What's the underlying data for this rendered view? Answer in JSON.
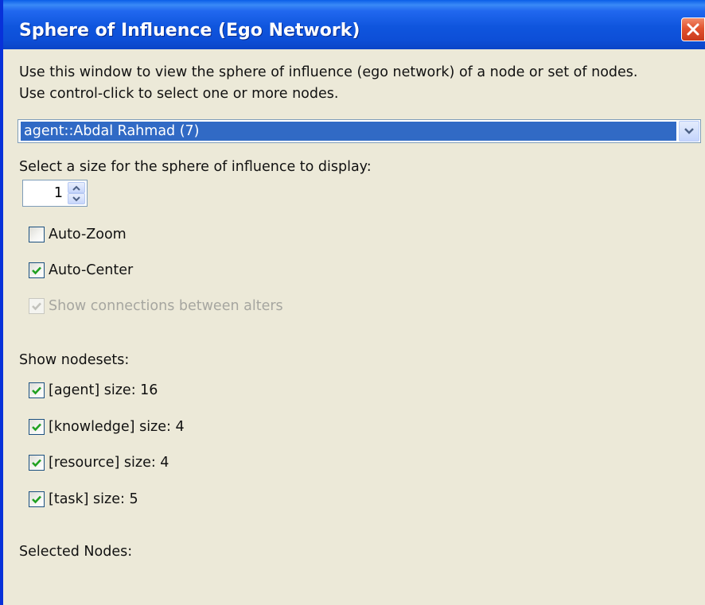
{
  "window": {
    "title": "Sphere of Influence (Ego Network)",
    "close_icon": "close-x-icon",
    "colors": {
      "titlebar": "#0f55dd",
      "frame": "#0831d9",
      "body": "#ece9d8",
      "selection": "#316ac5",
      "close": "#e2532f",
      "check": "#21a121"
    }
  },
  "description": {
    "line1": "Use this window to view the sphere of influence (ego network) of a node or set of nodes.",
    "line2": "Use control-click to select one or more nodes."
  },
  "node_select": {
    "value": "agent::Abdal Rahmad (7)",
    "icon": "chevron-down-icon"
  },
  "size": {
    "label": "Select a size for the sphere of influence to display:",
    "value": "1",
    "icons": [
      "spin-up-icon",
      "spin-down-icon"
    ]
  },
  "options": [
    {
      "label": "Auto-Zoom",
      "checked": false,
      "enabled": true
    },
    {
      "label": "Auto-Center",
      "checked": true,
      "enabled": true
    },
    {
      "label": "Show connections between alters",
      "checked": true,
      "enabled": false
    }
  ],
  "nodesets": {
    "label": "Show nodesets:",
    "items": [
      {
        "label": "[agent] size: 16",
        "checked": true
      },
      {
        "label": "[knowledge] size: 4",
        "checked": true
      },
      {
        "label": "[resource] size: 4",
        "checked": true
      },
      {
        "label": "[task] size: 5",
        "checked": true
      }
    ]
  },
  "selected_nodes": {
    "label": "Selected Nodes:"
  }
}
